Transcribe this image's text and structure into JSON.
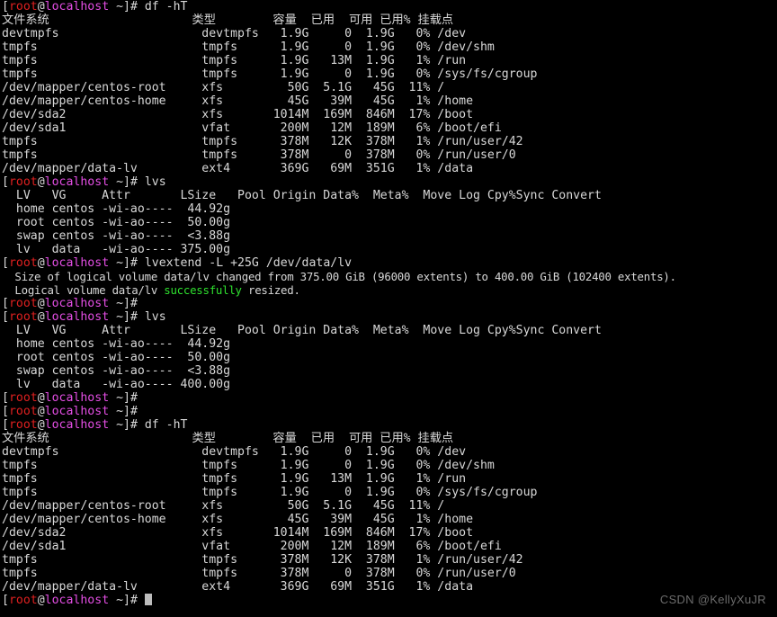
{
  "terminal": {
    "title": "root@localhost:~",
    "background_color": "#000000",
    "foreground_color": "#d8d8d8",
    "prompt": {
      "bracket_open": "[",
      "user": "root",
      "at": "@",
      "host": "localhost",
      "path": " ~]# ",
      "user_color": "#e02020",
      "host_color": "#e44ee4",
      "text_color": "#d8d8d8"
    },
    "cursor": {
      "shape": "block",
      "color": "#bdbdbd"
    },
    "commands": {
      "df": "df -hT",
      "lvs": "lvs",
      "lvextend": "lvextend -L +25G /dev/data/lv",
      "empty": ""
    },
    "df_table": {
      "headers": [
        "文件系统",
        "类型",
        "容量",
        "已用",
        "可用",
        "已用%",
        "挂载点"
      ],
      "header_line": "文件系统                    类型        容量  已用  可用 已用% 挂载点",
      "rows_before": [
        {
          "fs": "devtmpfs",
          "type": "devtmpfs",
          "size": "1.9G",
          "used": "0",
          "avail": "1.9G",
          "pct": "0%",
          "mount": "/dev"
        },
        {
          "fs": "tmpfs",
          "type": "tmpfs",
          "size": "1.9G",
          "used": "0",
          "avail": "1.9G",
          "pct": "0%",
          "mount": "/dev/shm"
        },
        {
          "fs": "tmpfs",
          "type": "tmpfs",
          "size": "1.9G",
          "used": "13M",
          "avail": "1.9G",
          "pct": "1%",
          "mount": "/run"
        },
        {
          "fs": "tmpfs",
          "type": "tmpfs",
          "size": "1.9G",
          "used": "0",
          "avail": "1.9G",
          "pct": "0%",
          "mount": "/sys/fs/cgroup"
        },
        {
          "fs": "/dev/mapper/centos-root",
          "type": "xfs",
          "size": "50G",
          "used": "5.1G",
          "avail": "45G",
          "pct": "11%",
          "mount": "/"
        },
        {
          "fs": "/dev/mapper/centos-home",
          "type": "xfs",
          "size": "45G",
          "used": "39M",
          "avail": "45G",
          "pct": "1%",
          "mount": "/home"
        },
        {
          "fs": "/dev/sda2",
          "type": "xfs",
          "size": "1014M",
          "used": "169M",
          "avail": "846M",
          "pct": "17%",
          "mount": "/boot"
        },
        {
          "fs": "/dev/sda1",
          "type": "vfat",
          "size": "200M",
          "used": "12M",
          "avail": "189M",
          "pct": "6%",
          "mount": "/boot/efi"
        },
        {
          "fs": "tmpfs",
          "type": "tmpfs",
          "size": "378M",
          "used": "12K",
          "avail": "378M",
          "pct": "1%",
          "mount": "/run/user/42"
        },
        {
          "fs": "tmpfs",
          "type": "tmpfs",
          "size": "378M",
          "used": "0",
          "avail": "378M",
          "pct": "0%",
          "mount": "/run/user/0"
        },
        {
          "fs": "/dev/mapper/data-lv",
          "type": "ext4",
          "size": "369G",
          "used": "69M",
          "avail": "351G",
          "pct": "1%",
          "mount": "/data"
        }
      ],
      "rows_after": [
        {
          "fs": "devtmpfs",
          "type": "devtmpfs",
          "size": "1.9G",
          "used": "0",
          "avail": "1.9G",
          "pct": "0%",
          "mount": "/dev"
        },
        {
          "fs": "tmpfs",
          "type": "tmpfs",
          "size": "1.9G",
          "used": "0",
          "avail": "1.9G",
          "pct": "0%",
          "mount": "/dev/shm"
        },
        {
          "fs": "tmpfs",
          "type": "tmpfs",
          "size": "1.9G",
          "used": "13M",
          "avail": "1.9G",
          "pct": "1%",
          "mount": "/run"
        },
        {
          "fs": "tmpfs",
          "type": "tmpfs",
          "size": "1.9G",
          "used": "0",
          "avail": "1.9G",
          "pct": "0%",
          "mount": "/sys/fs/cgroup"
        },
        {
          "fs": "/dev/mapper/centos-root",
          "type": "xfs",
          "size": "50G",
          "used": "5.1G",
          "avail": "45G",
          "pct": "11%",
          "mount": "/"
        },
        {
          "fs": "/dev/mapper/centos-home",
          "type": "xfs",
          "size": "45G",
          "used": "39M",
          "avail": "45G",
          "pct": "1%",
          "mount": "/home"
        },
        {
          "fs": "/dev/sda2",
          "type": "xfs",
          "size": "1014M",
          "used": "169M",
          "avail": "846M",
          "pct": "17%",
          "mount": "/boot"
        },
        {
          "fs": "/dev/sda1",
          "type": "vfat",
          "size": "200M",
          "used": "12M",
          "avail": "189M",
          "pct": "6%",
          "mount": "/boot/efi"
        },
        {
          "fs": "tmpfs",
          "type": "tmpfs",
          "size": "378M",
          "used": "12K",
          "avail": "378M",
          "pct": "1%",
          "mount": "/run/user/42"
        },
        {
          "fs": "tmpfs",
          "type": "tmpfs",
          "size": "378M",
          "used": "0",
          "avail": "378M",
          "pct": "0%",
          "mount": "/run/user/0"
        },
        {
          "fs": "/dev/mapper/data-lv",
          "type": "ext4",
          "size": "369G",
          "used": "69M",
          "avail": "351G",
          "pct": "1%",
          "mount": "/data"
        }
      ]
    },
    "lvs_table": {
      "headers": [
        "LV",
        "VG",
        "Attr",
        "LSize",
        "Pool",
        "Origin",
        "Data%",
        "Meta%",
        "Move",
        "Log",
        "Cpy%Sync",
        "Convert"
      ],
      "header_line": "  LV   VG     Attr       LSize   Pool Origin Data%  Meta%  Move Log Cpy%Sync Convert",
      "rows_before": [
        {
          "lv": "home",
          "vg": "centos",
          "attr": "-wi-ao----",
          "lsize": "44.92g"
        },
        {
          "lv": "root",
          "vg": "centos",
          "attr": "-wi-ao----",
          "lsize": "50.00g"
        },
        {
          "lv": "swap",
          "vg": "centos",
          "attr": "-wi-ao----",
          "lsize": "<3.88g"
        },
        {
          "lv": "lv",
          "vg": "data",
          "attr": "-wi-ao----",
          "lsize": "375.00g"
        }
      ],
      "rows_after": [
        {
          "lv": "home",
          "vg": "centos",
          "attr": "-wi-ao----",
          "lsize": "44.92g"
        },
        {
          "lv": "root",
          "vg": "centos",
          "attr": "-wi-ao----",
          "lsize": "50.00g"
        },
        {
          "lv": "swap",
          "vg": "centos",
          "attr": "-wi-ao----",
          "lsize": "<3.88g"
        },
        {
          "lv": "lv",
          "vg": "data",
          "attr": "-wi-ao----",
          "lsize": "400.00g"
        }
      ]
    },
    "lvextend_output": {
      "size_line": "  Size of logical volume data/lv changed from 375.00 GiB (96000 extents) to 400.00 GiB (102400 extents).",
      "resize_prefix": "  Logical volume data/lv ",
      "resize_success": "successfully",
      "resize_suffix": " resized.",
      "success_color": "#2ee02e",
      "old_size": "375.00 GiB",
      "old_extents": "96000",
      "new_size": "400.00 GiB",
      "new_extents": "102400"
    }
  },
  "watermark": {
    "text": "CSDN @KellyXuJR",
    "color": "#6b6b6b"
  }
}
